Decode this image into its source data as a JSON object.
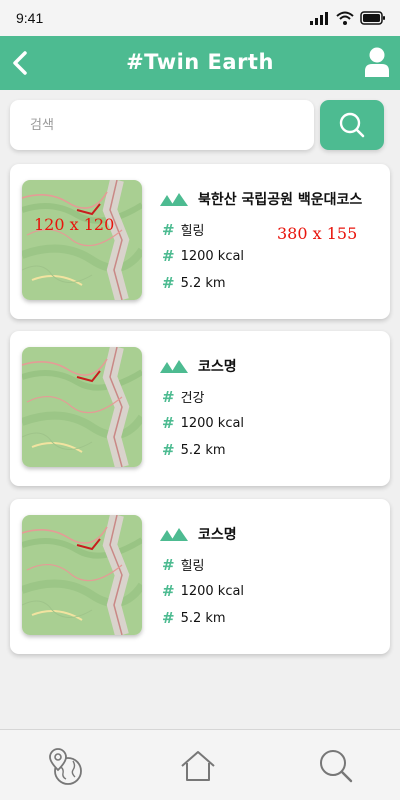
{
  "status": {
    "time": "9:41"
  },
  "app_bar": {
    "title": "#Twin Earth"
  },
  "search": {
    "placeholder": "검색"
  },
  "cards": [
    {
      "name": "북한산 국립공원 백운대코스",
      "tag": "힐링",
      "calories": "1200 kcal",
      "distance": "5.2 km",
      "thumb_label": "120 x 120",
      "size_label": "380 x 155"
    },
    {
      "name": "코스명",
      "tag": "건강",
      "calories": "1200 kcal",
      "distance": "5.2 km"
    },
    {
      "name": "코스명",
      "tag": "힐링",
      "calories": "1200 kcal",
      "distance": "5.2 km"
    }
  ],
  "icons": {
    "back": "chevron-left-icon",
    "profile": "user-icon",
    "search": "search-icon",
    "course": "mountain-icon",
    "tag": "hash-icon",
    "nav": [
      "map-pin-globe-icon",
      "home-icon",
      "search-icon"
    ]
  },
  "colors": {
    "primary": "#4dbb91",
    "annotation": "#e8140c",
    "background": "#f0f0f0"
  }
}
